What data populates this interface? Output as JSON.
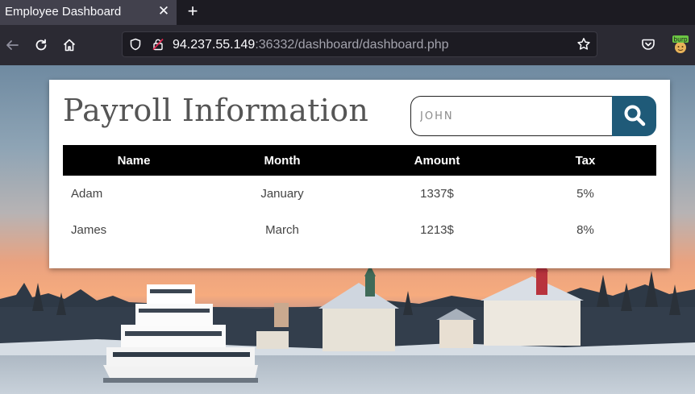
{
  "browser": {
    "tab_title": "Employee Dashboard",
    "tab_close": "✕",
    "new_tab": "+",
    "url_host": "94.237.55.149",
    "url_rest": ":36332/dashboard/dashboard.php",
    "extension_label": "burp"
  },
  "page": {
    "title": "Payroll Information",
    "search": {
      "value": "JOHN",
      "placeholder": "JOHN"
    },
    "table": {
      "headers": [
        "Name",
        "Month",
        "Amount",
        "Tax"
      ],
      "rows": [
        [
          "Adam",
          "January",
          "1337$",
          "5%"
        ],
        [
          "James",
          "March",
          "1213$",
          "8%"
        ]
      ]
    }
  }
}
